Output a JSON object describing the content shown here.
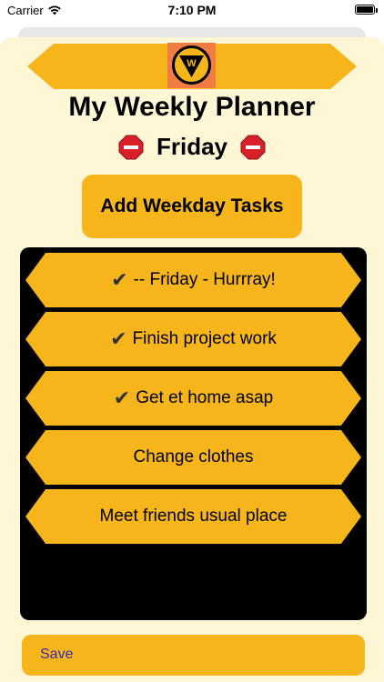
{
  "status_bar": {
    "carrier": "Carrier",
    "time": "7:10 PM"
  },
  "header": {
    "title": "My Weekly Planner",
    "day": "Friday",
    "logo_letter": "W",
    "day_icon": "stop-sign-icon"
  },
  "add_button": {
    "label": "Add Weekday Tasks"
  },
  "tasks": [
    {
      "label": "-- Friday - Hurrray!",
      "checked": true
    },
    {
      "label": "Finish project work",
      "checked": true
    },
    {
      "label": "Get et home asap",
      "checked": true
    },
    {
      "label": "Change clothes",
      "checked": false
    },
    {
      "label": "Meet friends usual place",
      "checked": false
    }
  ],
  "check_glyph": "✔",
  "footer": {
    "save_label": "Save"
  },
  "colors": {
    "accent": "#f7b51c",
    "sheet_background": "#fef6d5",
    "logo_background": "#f07c43",
    "save_text": "#3a2cae",
    "task_panel": "#000000"
  }
}
